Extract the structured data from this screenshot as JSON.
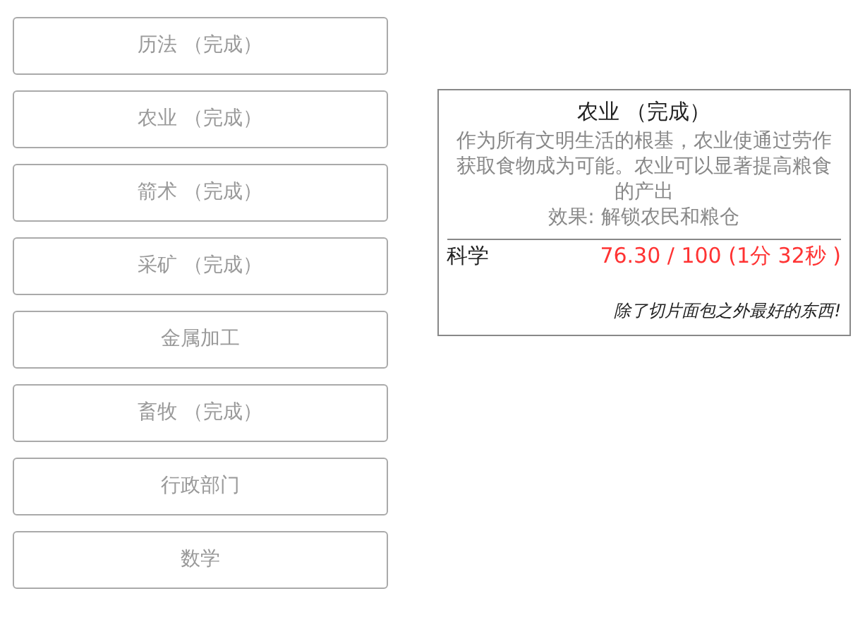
{
  "techs": [
    {
      "label": "历法 （完成）"
    },
    {
      "label": "农业 （完成）"
    },
    {
      "label": "箭术 （完成）"
    },
    {
      "label": "采矿 （完成）"
    },
    {
      "label": "金属加工"
    },
    {
      "label": "畜牧 （完成）"
    },
    {
      "label": "行政部门"
    },
    {
      "label": "数学"
    }
  ],
  "tooltip": {
    "title": "农业 （完成）",
    "description": "作为所有文明生活的根基，农业使通过劳作获取食物成为可能。农业可以显著提高粮食的产出",
    "effect": "效果: 解锁农民和粮仓",
    "cost_name": "科学",
    "cost_value": "76.30 / 100 (1分 32秒 )",
    "flavor": "除了切片面包之外最好的东西!"
  }
}
